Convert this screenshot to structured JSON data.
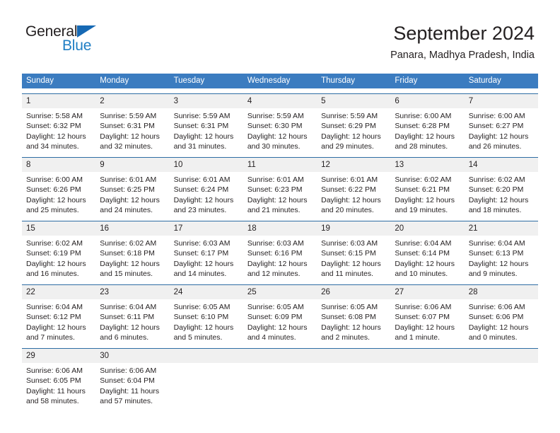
{
  "brand": {
    "name_part1": "General",
    "name_part2": "Blue"
  },
  "header": {
    "title": "September 2024",
    "subtitle": "Panara, Madhya Pradesh, India"
  },
  "colors": {
    "header_blue": "#3b7cc0",
    "row_rule": "#2e6da4",
    "daynum_band": "#f0f0f0",
    "brand_blue": "#1f7ec4",
    "text": "#231f20"
  },
  "weekdays": [
    "Sunday",
    "Monday",
    "Tuesday",
    "Wednesday",
    "Thursday",
    "Friday",
    "Saturday"
  ],
  "weeks": [
    [
      {
        "day": "1",
        "sunrise": "Sunrise: 5:58 AM",
        "sunset": "Sunset: 6:32 PM",
        "daylight1": "Daylight: 12 hours",
        "daylight2": "and 34 minutes."
      },
      {
        "day": "2",
        "sunrise": "Sunrise: 5:59 AM",
        "sunset": "Sunset: 6:31 PM",
        "daylight1": "Daylight: 12 hours",
        "daylight2": "and 32 minutes."
      },
      {
        "day": "3",
        "sunrise": "Sunrise: 5:59 AM",
        "sunset": "Sunset: 6:31 PM",
        "daylight1": "Daylight: 12 hours",
        "daylight2": "and 31 minutes."
      },
      {
        "day": "4",
        "sunrise": "Sunrise: 5:59 AM",
        "sunset": "Sunset: 6:30 PM",
        "daylight1": "Daylight: 12 hours",
        "daylight2": "and 30 minutes."
      },
      {
        "day": "5",
        "sunrise": "Sunrise: 5:59 AM",
        "sunset": "Sunset: 6:29 PM",
        "daylight1": "Daylight: 12 hours",
        "daylight2": "and 29 minutes."
      },
      {
        "day": "6",
        "sunrise": "Sunrise: 6:00 AM",
        "sunset": "Sunset: 6:28 PM",
        "daylight1": "Daylight: 12 hours",
        "daylight2": "and 28 minutes."
      },
      {
        "day": "7",
        "sunrise": "Sunrise: 6:00 AM",
        "sunset": "Sunset: 6:27 PM",
        "daylight1": "Daylight: 12 hours",
        "daylight2": "and 26 minutes."
      }
    ],
    [
      {
        "day": "8",
        "sunrise": "Sunrise: 6:00 AM",
        "sunset": "Sunset: 6:26 PM",
        "daylight1": "Daylight: 12 hours",
        "daylight2": "and 25 minutes."
      },
      {
        "day": "9",
        "sunrise": "Sunrise: 6:01 AM",
        "sunset": "Sunset: 6:25 PM",
        "daylight1": "Daylight: 12 hours",
        "daylight2": "and 24 minutes."
      },
      {
        "day": "10",
        "sunrise": "Sunrise: 6:01 AM",
        "sunset": "Sunset: 6:24 PM",
        "daylight1": "Daylight: 12 hours",
        "daylight2": "and 23 minutes."
      },
      {
        "day": "11",
        "sunrise": "Sunrise: 6:01 AM",
        "sunset": "Sunset: 6:23 PM",
        "daylight1": "Daylight: 12 hours",
        "daylight2": "and 21 minutes."
      },
      {
        "day": "12",
        "sunrise": "Sunrise: 6:01 AM",
        "sunset": "Sunset: 6:22 PM",
        "daylight1": "Daylight: 12 hours",
        "daylight2": "and 20 minutes."
      },
      {
        "day": "13",
        "sunrise": "Sunrise: 6:02 AM",
        "sunset": "Sunset: 6:21 PM",
        "daylight1": "Daylight: 12 hours",
        "daylight2": "and 19 minutes."
      },
      {
        "day": "14",
        "sunrise": "Sunrise: 6:02 AM",
        "sunset": "Sunset: 6:20 PM",
        "daylight1": "Daylight: 12 hours",
        "daylight2": "and 18 minutes."
      }
    ],
    [
      {
        "day": "15",
        "sunrise": "Sunrise: 6:02 AM",
        "sunset": "Sunset: 6:19 PM",
        "daylight1": "Daylight: 12 hours",
        "daylight2": "and 16 minutes."
      },
      {
        "day": "16",
        "sunrise": "Sunrise: 6:02 AM",
        "sunset": "Sunset: 6:18 PM",
        "daylight1": "Daylight: 12 hours",
        "daylight2": "and 15 minutes."
      },
      {
        "day": "17",
        "sunrise": "Sunrise: 6:03 AM",
        "sunset": "Sunset: 6:17 PM",
        "daylight1": "Daylight: 12 hours",
        "daylight2": "and 14 minutes."
      },
      {
        "day": "18",
        "sunrise": "Sunrise: 6:03 AM",
        "sunset": "Sunset: 6:16 PM",
        "daylight1": "Daylight: 12 hours",
        "daylight2": "and 12 minutes."
      },
      {
        "day": "19",
        "sunrise": "Sunrise: 6:03 AM",
        "sunset": "Sunset: 6:15 PM",
        "daylight1": "Daylight: 12 hours",
        "daylight2": "and 11 minutes."
      },
      {
        "day": "20",
        "sunrise": "Sunrise: 6:04 AM",
        "sunset": "Sunset: 6:14 PM",
        "daylight1": "Daylight: 12 hours",
        "daylight2": "and 10 minutes."
      },
      {
        "day": "21",
        "sunrise": "Sunrise: 6:04 AM",
        "sunset": "Sunset: 6:13 PM",
        "daylight1": "Daylight: 12 hours",
        "daylight2": "and 9 minutes."
      }
    ],
    [
      {
        "day": "22",
        "sunrise": "Sunrise: 6:04 AM",
        "sunset": "Sunset: 6:12 PM",
        "daylight1": "Daylight: 12 hours",
        "daylight2": "and 7 minutes."
      },
      {
        "day": "23",
        "sunrise": "Sunrise: 6:04 AM",
        "sunset": "Sunset: 6:11 PM",
        "daylight1": "Daylight: 12 hours",
        "daylight2": "and 6 minutes."
      },
      {
        "day": "24",
        "sunrise": "Sunrise: 6:05 AM",
        "sunset": "Sunset: 6:10 PM",
        "daylight1": "Daylight: 12 hours",
        "daylight2": "and 5 minutes."
      },
      {
        "day": "25",
        "sunrise": "Sunrise: 6:05 AM",
        "sunset": "Sunset: 6:09 PM",
        "daylight1": "Daylight: 12 hours",
        "daylight2": "and 4 minutes."
      },
      {
        "day": "26",
        "sunrise": "Sunrise: 6:05 AM",
        "sunset": "Sunset: 6:08 PM",
        "daylight1": "Daylight: 12 hours",
        "daylight2": "and 2 minutes."
      },
      {
        "day": "27",
        "sunrise": "Sunrise: 6:06 AM",
        "sunset": "Sunset: 6:07 PM",
        "daylight1": "Daylight: 12 hours",
        "daylight2": "and 1 minute."
      },
      {
        "day": "28",
        "sunrise": "Sunrise: 6:06 AM",
        "sunset": "Sunset: 6:06 PM",
        "daylight1": "Daylight: 12 hours",
        "daylight2": "and 0 minutes."
      }
    ],
    [
      {
        "day": "29",
        "sunrise": "Sunrise: 6:06 AM",
        "sunset": "Sunset: 6:05 PM",
        "daylight1": "Daylight: 11 hours",
        "daylight2": "and 58 minutes."
      },
      {
        "day": "30",
        "sunrise": "Sunrise: 6:06 AM",
        "sunset": "Sunset: 6:04 PM",
        "daylight1": "Daylight: 11 hours",
        "daylight2": "and 57 minutes."
      },
      {
        "day": "",
        "sunrise": "",
        "sunset": "",
        "daylight1": "",
        "daylight2": ""
      },
      {
        "day": "",
        "sunrise": "",
        "sunset": "",
        "daylight1": "",
        "daylight2": ""
      },
      {
        "day": "",
        "sunrise": "",
        "sunset": "",
        "daylight1": "",
        "daylight2": ""
      },
      {
        "day": "",
        "sunrise": "",
        "sunset": "",
        "daylight1": "",
        "daylight2": ""
      },
      {
        "day": "",
        "sunrise": "",
        "sunset": "",
        "daylight1": "",
        "daylight2": ""
      }
    ]
  ]
}
